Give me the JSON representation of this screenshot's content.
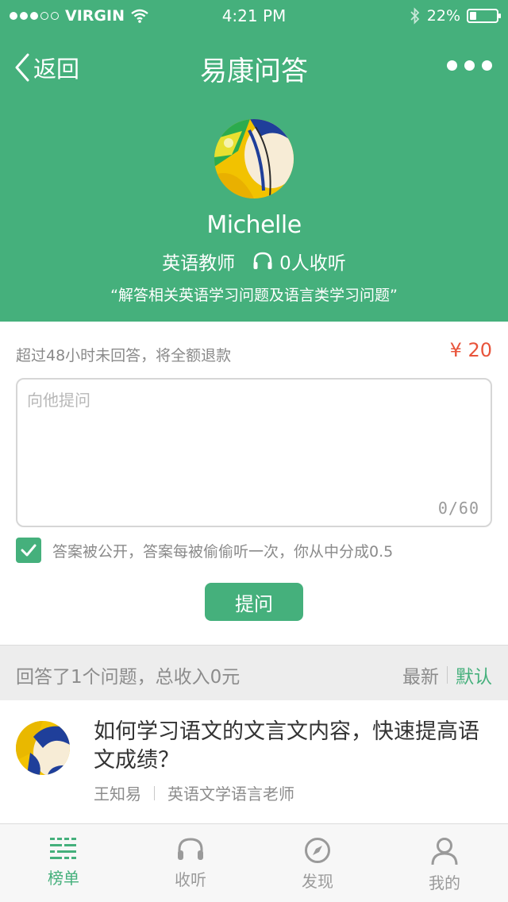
{
  "status_bar": {
    "carrier": "VIRGIN",
    "time": "4:21 PM",
    "battery": "22%",
    "battery_fraction": 0.22
  },
  "nav": {
    "back_label": "返回",
    "title": "易康问答"
  },
  "profile": {
    "name": "Michelle",
    "role": "英语教师",
    "listeners": "0人收听",
    "intro": "“解答相关英语学习问题及语言类学习问题”"
  },
  "ask": {
    "refund_note": "超过48小时未回答，将全额退款",
    "price": "¥ 20",
    "placeholder": "向他提问",
    "counter": "0/60",
    "agree_text": "答案被公开，答案每被偷偷听一次，你从中分成0.5",
    "agree_checked": true,
    "submit_label": "提问"
  },
  "answers_bar": {
    "summary": "回答了1个问题，总收入0元",
    "sort_latest": "最新",
    "sort_default": "默认"
  },
  "questions": [
    {
      "title": "如何学习语文的文言文内容，快速提高语文成绩？",
      "author": "王知易",
      "author_title": "英语文学语言老师"
    }
  ],
  "tabbar": {
    "items": [
      {
        "label": "榜单",
        "icon": "list-icon",
        "active": true
      },
      {
        "label": "收听",
        "icon": "headphones-icon",
        "active": false
      },
      {
        "label": "发现",
        "icon": "compass-icon",
        "active": false
      },
      {
        "label": "我的",
        "icon": "person-icon",
        "active": false
      }
    ]
  },
  "colors": {
    "brand_green": "#45b07c",
    "price_red": "#e8543b"
  }
}
